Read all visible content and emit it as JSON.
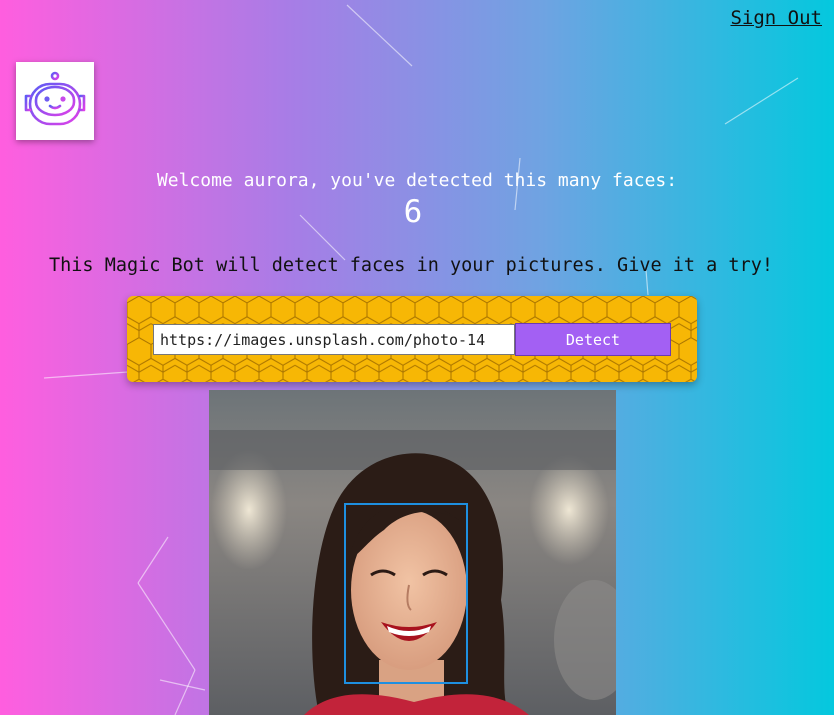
{
  "nav": {
    "sign_out_label": "Sign Out"
  },
  "logo": {
    "icon": "robot-icon"
  },
  "welcome": {
    "text": "Welcome aurora, you've detected this many faces:",
    "count": "6"
  },
  "intro": {
    "text": "This Magic Bot will detect faces in your pictures. Give it a try!"
  },
  "form": {
    "url_value": "https://images.unsplash.com/photo-14",
    "detect_label": "Detect"
  },
  "result": {
    "image_description_icon": "smiling-woman-photo",
    "face_box_color": "#1e8fe0"
  },
  "colors": {
    "panel": "#f7b705",
    "button": "#a360f3",
    "gradient_left": "#ff5edf",
    "gradient_right": "#04c8de"
  }
}
